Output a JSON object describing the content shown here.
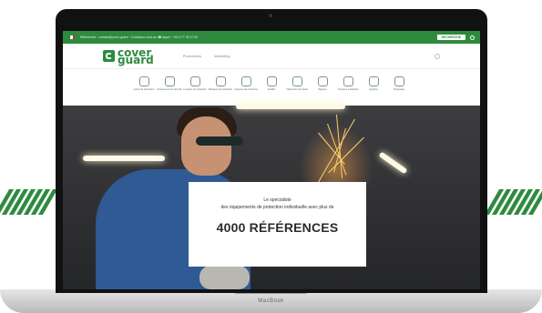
{
  "topbar": {
    "info": "Référencés : contact@cover-guard · Contactez-nous au ☎ Appel : +33 4 77 36 37 52",
    "search_label": "RECHERCHE",
    "flag_colors": [
      "#009246",
      "#ffffff",
      "#ce2b37"
    ]
  },
  "header": {
    "logo_line1": "cover",
    "logo_line2": "guard",
    "nav": [
      "Promotions",
      "Marketing"
    ]
  },
  "categories": [
    "Gants de protection",
    "Chaussures de sécurité",
    "Lunettes de protection",
    "Masques de protection",
    "Casques de protection",
    "Auditifs",
    "Vêtements de travail",
    "Signaux",
    "Trousses médicales",
    "Hygiène",
    "Marquage"
  ],
  "hero": {
    "line1": "Le spécialiste",
    "line2": "des équipements de protection individuelle avec plus de",
    "headline": "4000 RÉFÉRENCES"
  },
  "device": {
    "brand": "MacBook"
  },
  "colors": {
    "accent": "#2e8b3e"
  }
}
